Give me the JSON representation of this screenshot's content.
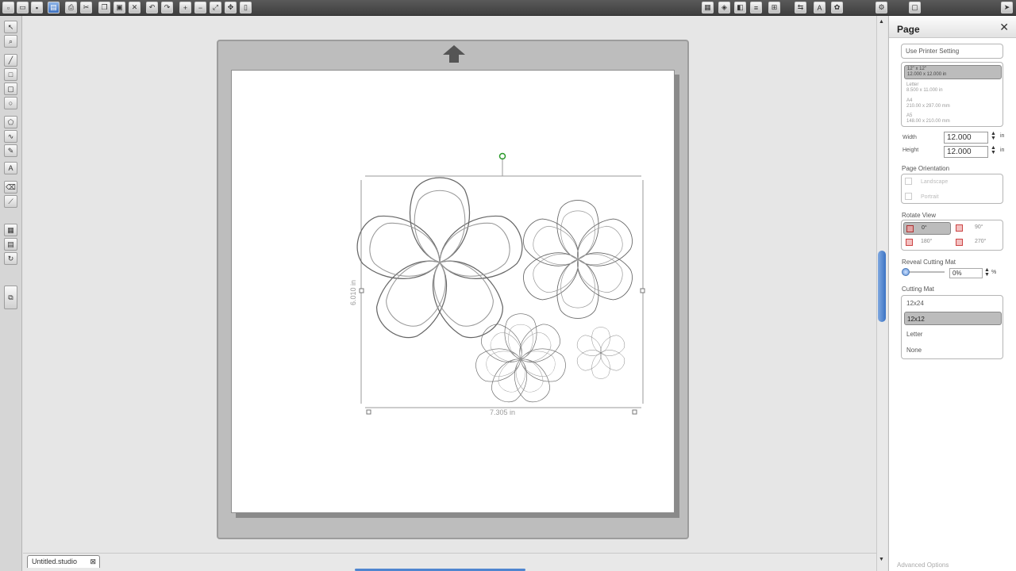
{
  "toolbar": {
    "left_icons": [
      "new-icon",
      "open-icon",
      "save-icon",
      "library-icon",
      "print-icon",
      "cut-icon",
      "copy-icon",
      "paste-icon",
      "delete-icon",
      "undo-icon",
      "redo-icon",
      "zoom-in-icon",
      "zoom-out-icon",
      "zoom-fit-icon",
      "pan-icon",
      "page-icon"
    ],
    "right_icons": [
      "group-icon",
      "layers-icon",
      "fill-icon",
      "line-icon",
      "align-icon",
      "replicate-icon",
      "text-icon",
      "offset-icon",
      "trace-icon",
      "store-icon",
      "send-icon"
    ]
  },
  "left_tools": [
    "select-icon",
    "zoom-tool-icon",
    "line-icon",
    "rectangle-icon",
    "rounded-rect-icon",
    "ellipse-icon",
    "polygon-icon",
    "curve-icon",
    "freehand-icon",
    "text-tool-icon",
    "eraser-icon",
    "knife-icon",
    "group-tool-icon",
    "layer-tool-icon",
    "rotate-icon",
    "weld-icon"
  ],
  "canvas": {
    "dimension_width": "7.305 in",
    "dimension_height": "6.010 in"
  },
  "panel": {
    "title": "Page",
    "use_printer_setting": "Use Printer Setting",
    "sizes": [
      {
        "name": "12\" x 12\"",
        "dims": "12.000 x 12.000 in",
        "selected": true
      },
      {
        "name": "Letter",
        "dims": "8.500 x 11.000 in",
        "selected": false
      },
      {
        "name": "A4",
        "dims": "210.00 x 297.00 mm",
        "selected": false
      },
      {
        "name": "A5",
        "dims": "148.00 x 210.00 mm",
        "selected": false
      }
    ],
    "width_label": "Width",
    "width_value": "12.000",
    "height_label": "Height",
    "height_value": "12.000",
    "unit": "in",
    "orientation_label": "Page Orientation",
    "orientation_options": [
      "Landscape",
      "Portrait"
    ],
    "rotate_label": "Rotate View",
    "rotate_options": [
      "0°",
      "90°",
      "180°",
      "270°"
    ],
    "reveal_label": "Reveal Cutting Mat",
    "reveal_value": "0%",
    "reveal_unit": "%",
    "mat_label": "Cutting Mat",
    "mat_options": [
      {
        "label": "12x24",
        "selected": false
      },
      {
        "label": "12x12",
        "selected": true
      },
      {
        "label": "Letter",
        "selected": false
      },
      {
        "label": "None",
        "selected": false
      }
    ],
    "advanced": "Advanced Options"
  },
  "tab": {
    "label": "Untitled.studio"
  }
}
